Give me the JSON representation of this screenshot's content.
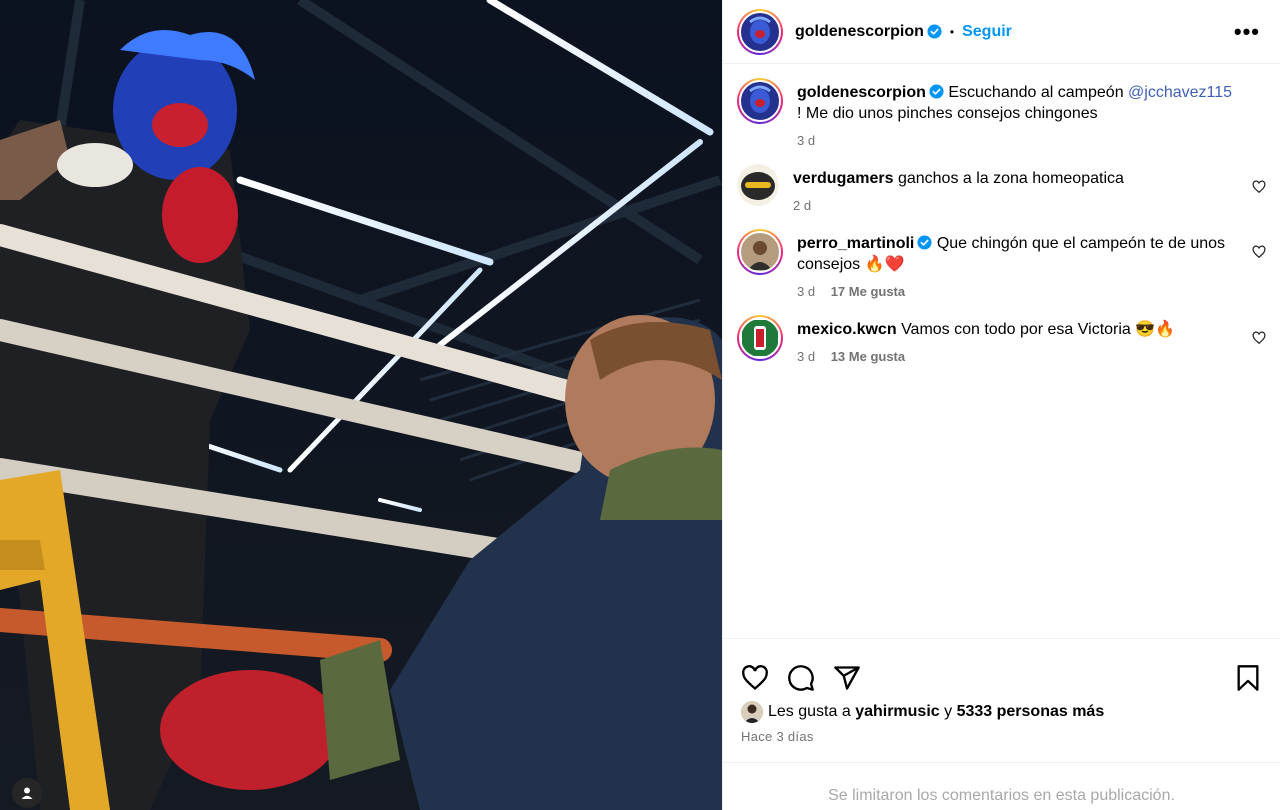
{
  "header": {
    "username": "goldenescorpion",
    "separator": "•",
    "follow_label": "Seguir",
    "more_label": "•••"
  },
  "caption": {
    "username": "goldenescorpion",
    "text_before": "Escuchando al campeón",
    "mention": "@jcchavez115",
    "text_after": "! Me dio unos pinches consejos chingones",
    "time": "3 d"
  },
  "comments": [
    {
      "username": "verdugamers",
      "text": "ganchos a la zona homeopatica",
      "time": "2 d",
      "likes": ""
    },
    {
      "username": "perro_martinoli",
      "text": "Que chingón que el campeón te de unos consejos 🔥❤️",
      "time": "3 d",
      "likes": "17 Me gusta"
    },
    {
      "username": "mexico.kwcn",
      "text": "Vamos con todo por esa Victoria 😎🔥",
      "time": "3 d",
      "likes": "13 Me gusta"
    }
  ],
  "likes": {
    "prefix": "Les gusta a",
    "user": "yahirmusic",
    "conj": "y",
    "others": "5333 personas más"
  },
  "posted": "Hace 3 días",
  "limited_notice": "Se limitaron los comentarios en esta publicación.",
  "icons": {
    "like": "heart-icon",
    "comment": "comment-icon",
    "share": "paper-plane-icon",
    "save": "bookmark-icon",
    "verified": "verified-badge-icon",
    "tag": "user-tag-icon"
  },
  "colors": {
    "link": "#0095f6",
    "mention": "#3f5fb8",
    "secondary": "#737373",
    "verified": "#0095f6"
  }
}
